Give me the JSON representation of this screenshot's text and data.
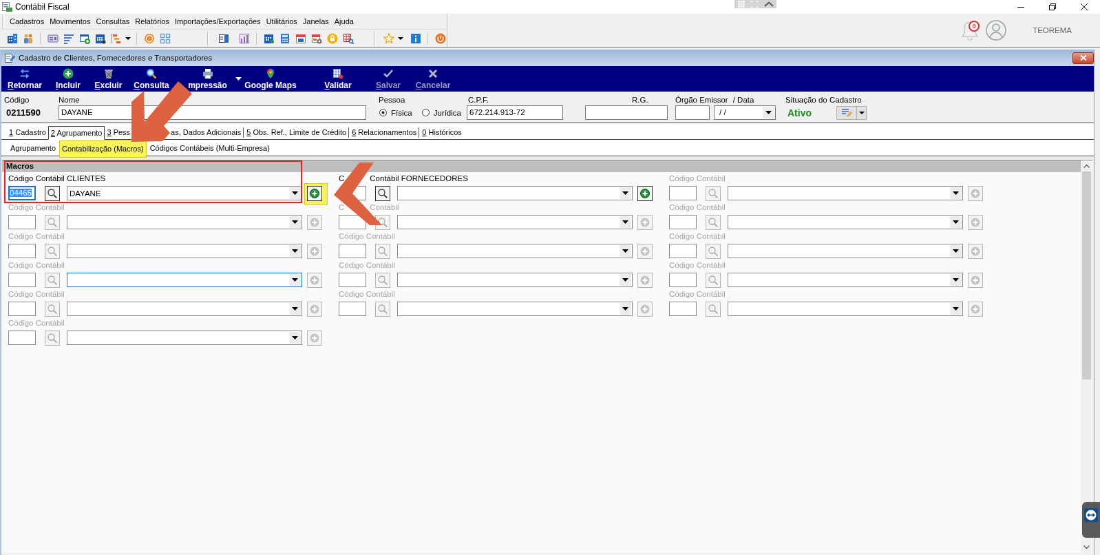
{
  "app": {
    "title": "Contábil Fiscal"
  },
  "menu": [
    "Cadastros",
    "Movimentos",
    "Consultas",
    "Relatórios",
    "Importações/Exportações",
    "Utilitários",
    "Janelas",
    "Ajuda"
  ],
  "account": {
    "notifications": "0",
    "user": "TEOREMA"
  },
  "window": {
    "title": "Cadastro de Clientes, Fornecedores e Transportadores"
  },
  "actions": [
    {
      "label": "Retornar",
      "disabled": false,
      "underline_first": true,
      "has_menu": false
    },
    {
      "label": "Incluir",
      "disabled": false,
      "underline_first": true,
      "has_menu": false
    },
    {
      "label": "Excluir",
      "disabled": false,
      "underline_first": true,
      "has_menu": false
    },
    {
      "label": "Consulta",
      "disabled": false,
      "underline_first": true,
      "has_menu": false
    },
    {
      "label": "mpressão",
      "disabled": false,
      "underline_first": false,
      "has_menu": true
    },
    {
      "label": "Google Maps",
      "disabled": false,
      "underline_first": false,
      "has_menu": false
    },
    {
      "label": "Validar",
      "disabled": false,
      "underline_first": true,
      "has_menu": false
    },
    {
      "label": "Salvar",
      "disabled": true,
      "underline_first": true,
      "has_menu": false
    },
    {
      "label": "Cancelar",
      "disabled": true,
      "underline_first": true,
      "has_menu": false
    }
  ],
  "record": {
    "code_label": "Código",
    "code": "0211590",
    "name_label": "Nome",
    "name": "DAYANE",
    "person_label": "Pessoa",
    "person_types": [
      {
        "label": "Física",
        "selected": true
      },
      {
        "label": "Jurídica",
        "selected": false
      }
    ],
    "cpf_label": "C.P.F.",
    "cpf": "672.214.913-72",
    "rg_label": "R.G.",
    "issuer_label": "Órgão Emissor",
    "date_label": "/ Data",
    "date": "/ /",
    "status_label": "Situação do Cadastro",
    "status": "Ativo"
  },
  "tabs": [
    {
      "label": "1 Cadastro",
      "selected": false,
      "underline_first": true,
      "covered": false
    },
    {
      "label": "2 Agrupamento",
      "selected": true,
      "underline_first": true,
      "covered": false
    },
    {
      "label": "3 Pess",
      "selected": false,
      "underline_first": true,
      "covered": true
    },
    {
      "label": "as, Dados Adicionais",
      "selected": false,
      "underline_first": false,
      "covered": true
    },
    {
      "label": "5 Obs. Ref., Limite de Crédito",
      "selected": false,
      "underline_first": true,
      "covered": false
    },
    {
      "label": "6 Relacionamentos",
      "selected": false,
      "underline_first": true,
      "covered": false
    },
    {
      "label": "0 Históricos",
      "selected": false,
      "underline_first": true,
      "covered": false
    }
  ],
  "subtabs": [
    {
      "label": "Agrupamento",
      "selected": false,
      "highlighted": false
    },
    {
      "label": "Contabilização (Macros)",
      "selected": true,
      "highlighted": true
    },
    {
      "label": "Códigos Contábeis (Multi-Empresa)",
      "selected": false,
      "highlighted": false
    }
  ],
  "macros": {
    "title": "Macros",
    "columns": [
      {
        "fields": [
          {
            "label": [
              "Código Contábil CLIENTES"
            ],
            "enabled": true,
            "code": "04465",
            "code_focused": true,
            "code_covered": false,
            "value": "DAYANE",
            "dropdown_focused": false,
            "add_highlighted": true
          },
          {
            "label": [
              "Código Contábil"
            ],
            "enabled": false,
            "code_focused": false,
            "code_covered": false,
            "dropdown_focused": false,
            "add_highlighted": false
          },
          {
            "label": [
              "Código Contábil"
            ],
            "enabled": false,
            "code_focused": false,
            "code_covered": false,
            "dropdown_focused": false,
            "add_highlighted": false
          },
          {
            "label": [
              "Código Contábil"
            ],
            "enabled": false,
            "code_focused": false,
            "code_covered": false,
            "dropdown_focused": true,
            "add_highlighted": false
          },
          {
            "label": [
              "Código Contábil"
            ],
            "enabled": false,
            "code_focused": false,
            "code_covered": false,
            "dropdown_focused": false,
            "add_highlighted": false
          },
          {
            "label": [
              "Código Contábil"
            ],
            "enabled": false,
            "code_focused": false,
            "code_covered": false,
            "dropdown_focused": false,
            "add_highlighted": false
          }
        ]
      },
      {
        "fields": [
          {
            "label": [
              "C",
              "Contábil FORNECEDORES"
            ],
            "enabled": true,
            "code_focused": false,
            "code_covered": true,
            "dropdown_focused": false,
            "add_highlighted": false
          },
          {
            "label": [
              "C",
              "Contábil"
            ],
            "enabled": false,
            "code_focused": false,
            "code_covered": false,
            "dropdown_focused": false,
            "add_highlighted": false
          },
          {
            "label": [
              "Código Contábil"
            ],
            "enabled": false,
            "code_focused": false,
            "code_covered": false,
            "dropdown_focused": false,
            "add_highlighted": false
          },
          {
            "label": [
              "Código Contábil"
            ],
            "enabled": false,
            "code_focused": false,
            "code_covered": false,
            "dropdown_focused": false,
            "add_highlighted": false
          },
          {
            "label": [
              "Código Contábil"
            ],
            "enabled": false,
            "code_focused": false,
            "code_covered": false,
            "dropdown_focused": false,
            "add_highlighted": false
          }
        ]
      },
      {
        "fields": [
          {
            "label": [
              "Código Contábil"
            ],
            "enabled": false,
            "code_focused": false,
            "code_covered": false,
            "dropdown_focused": false,
            "add_highlighted": false
          },
          {
            "label": [
              "Código Contábil"
            ],
            "enabled": false,
            "code_focused": false,
            "code_covered": false,
            "dropdown_focused": false,
            "add_highlighted": false
          },
          {
            "label": [
              "Código Contábil"
            ],
            "enabled": false,
            "code_focused": false,
            "code_covered": false,
            "dropdown_focused": false,
            "add_highlighted": false
          },
          {
            "label": [
              "Código Contábil"
            ],
            "enabled": false,
            "code_focused": false,
            "code_covered": false,
            "dropdown_focused": false,
            "add_highlighted": false
          },
          {
            "label": [
              "Código Contábil"
            ],
            "enabled": false,
            "code_focused": false,
            "code_covered": false,
            "dropdown_focused": false,
            "add_highlighted": false
          }
        ]
      }
    ]
  }
}
